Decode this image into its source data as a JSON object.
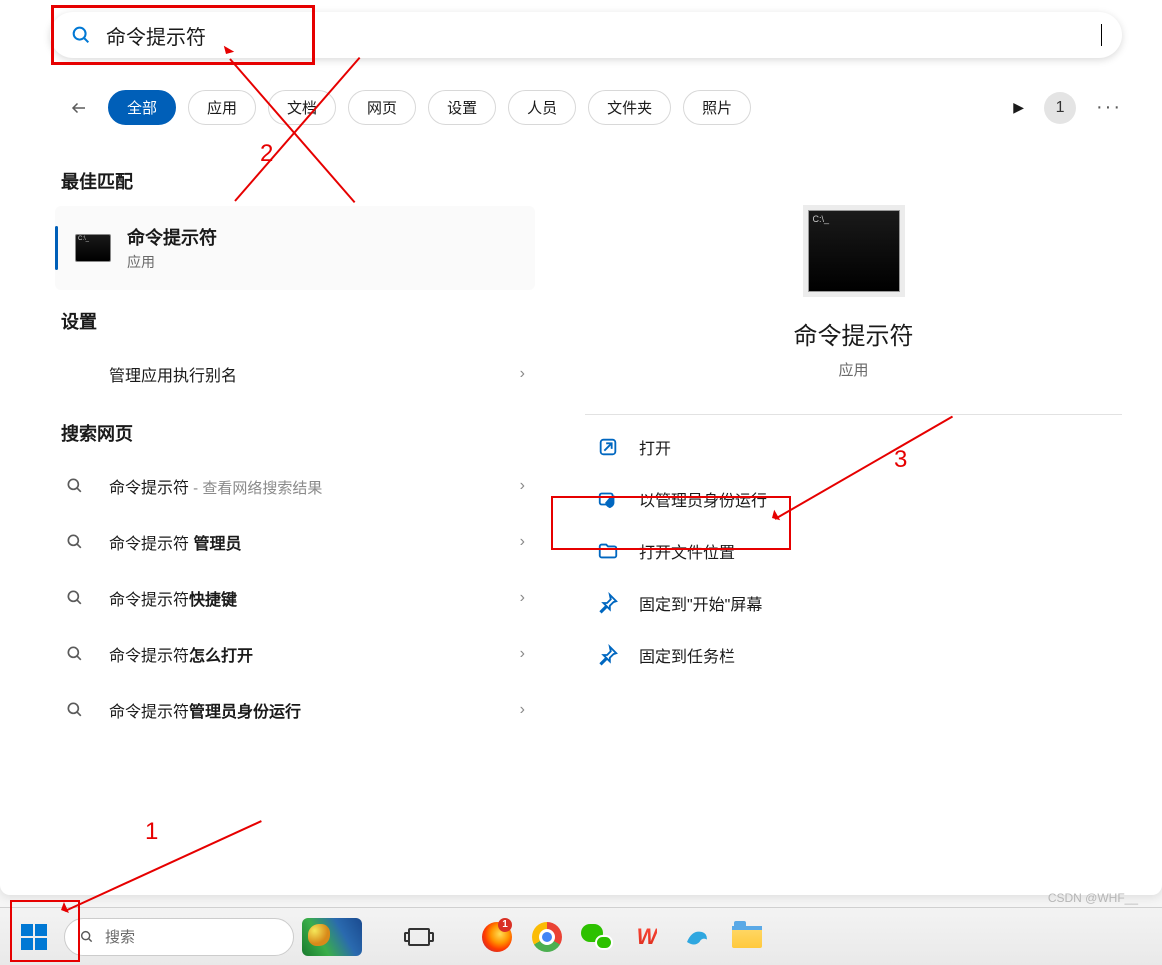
{
  "search": {
    "value": "命令提示符"
  },
  "filters": {
    "tabs": [
      "全部",
      "应用",
      "文档",
      "网页",
      "设置",
      "人员",
      "文件夹",
      "照片"
    ],
    "active_index": 0,
    "badge": "1"
  },
  "left": {
    "best_match_header": "最佳匹配",
    "best_match": {
      "title": "命令提示符",
      "subtitle": "应用"
    },
    "settings_header": "设置",
    "settings_items": [
      {
        "label": "管理应用执行别名"
      }
    ],
    "web_header": "搜索网页",
    "web_items": [
      {
        "prefix": "命令提示符",
        "bold": "",
        "suffix": " - 查看网络搜索结果"
      },
      {
        "prefix": "命令提示符 ",
        "bold": "管理员",
        "suffix": ""
      },
      {
        "prefix": "命令提示符",
        "bold": "快捷键",
        "suffix": ""
      },
      {
        "prefix": "命令提示符",
        "bold": "怎么打开",
        "suffix": ""
      },
      {
        "prefix": "命令提示符",
        "bold": "管理员身份运行",
        "suffix": ""
      }
    ]
  },
  "right": {
    "title": "命令提示符",
    "subtitle": "应用",
    "actions": [
      {
        "icon": "open",
        "label": "打开"
      },
      {
        "icon": "shield",
        "label": "以管理员身份运行"
      },
      {
        "icon": "folder",
        "label": "打开文件位置"
      },
      {
        "icon": "pin",
        "label": "固定到\"开始\"屏幕"
      },
      {
        "icon": "pin",
        "label": "固定到任务栏"
      }
    ]
  },
  "taskbar": {
    "search_placeholder": "搜索",
    "apps": [
      "taskview",
      "firefox",
      "chrome",
      "wechat",
      "wps",
      "dolphin",
      "explorer"
    ]
  },
  "annotations": {
    "n1": "1",
    "n2": "2",
    "n3": "3"
  },
  "watermark": "CSDN @WHF__"
}
